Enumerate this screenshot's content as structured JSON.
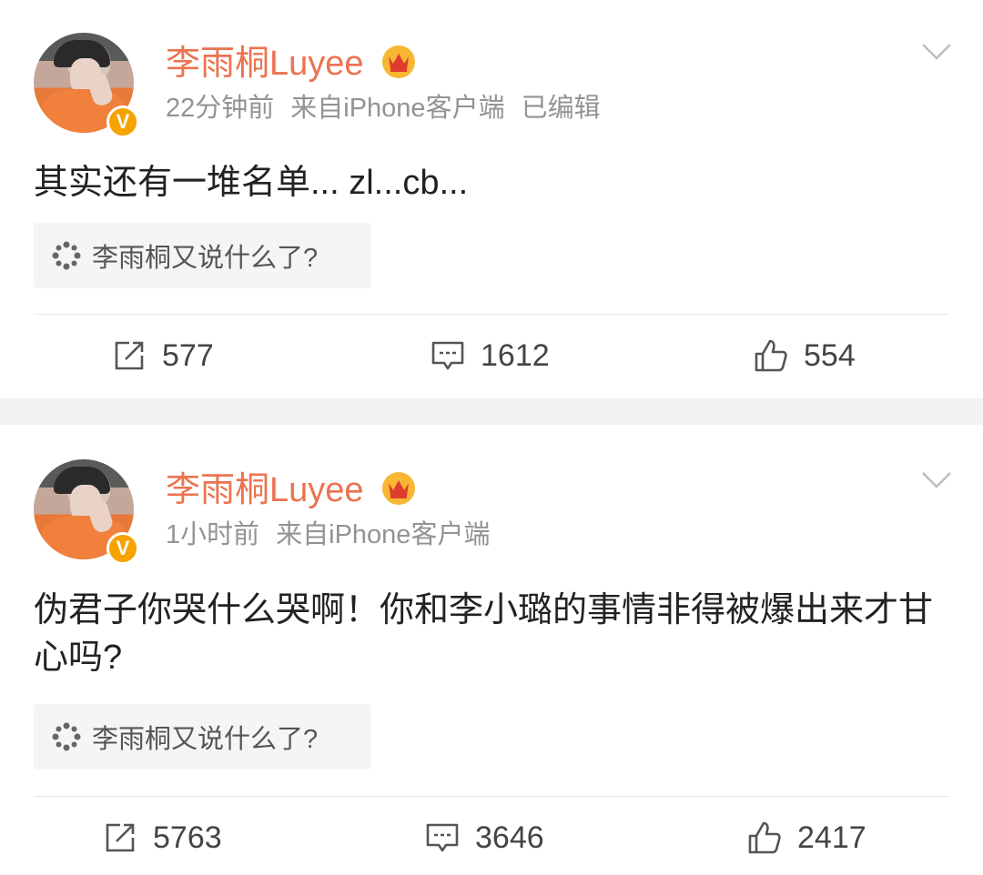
{
  "posts": [
    {
      "username": "李雨桐Luyee",
      "time": "22分钟前",
      "source": "来自iPhone客户端",
      "edited": "已编辑",
      "content": "其实还有一堆名单... zl...cb...",
      "topic": "李雨桐又说什么了?",
      "reposts": "577",
      "comments": "1612",
      "likes": "554"
    },
    {
      "username": "李雨桐Luyee",
      "time": "1小时前",
      "source": "来自iPhone客户端",
      "content": "伪君子你哭什么哭啊！你和李小璐的事情非得被爆出来才甘心吗?",
      "topic": "李雨桐又说什么了?",
      "reposts": "5763",
      "comments": "3646",
      "likes": "2417"
    }
  ],
  "verified_badge": "V",
  "colors": {
    "username": "#eb7350",
    "meta": "#939393",
    "badge": "#f6a300",
    "separator": "#f2f2f2"
  },
  "icons": [
    "crown-icon",
    "chevron-down-icon",
    "topic-icon",
    "repost-icon",
    "comment-icon",
    "like-icon"
  ]
}
